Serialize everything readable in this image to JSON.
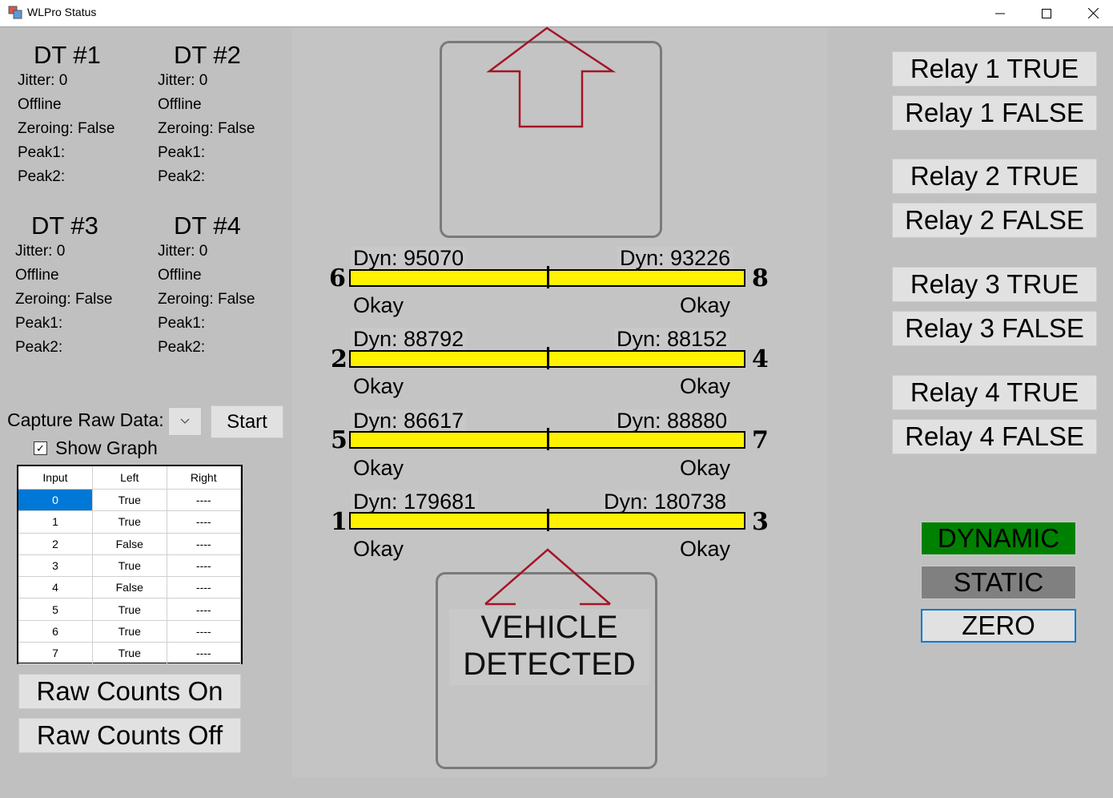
{
  "window": {
    "title": "WLPro Status"
  },
  "detectors": [
    {
      "title": "DT #1",
      "jitter": "Jitter: 0",
      "status": "Offline",
      "zeroing": "Zeroing: False",
      "peak1": "Peak1:",
      "peak2": "Peak2:"
    },
    {
      "title": "DT #2",
      "jitter": "Jitter: 0",
      "status": "Offline",
      "zeroing": "Zeroing: False",
      "peak1": "Peak1:",
      "peak2": "Peak2:"
    },
    {
      "title": "DT #3",
      "jitter": "Jitter: 0",
      "status": "Offline",
      "zeroing": "Zeroing: False",
      "peak1": "Peak1:",
      "peak2": "Peak2:"
    },
    {
      "title": "DT #4",
      "jitter": "Jitter: 0",
      "status": "Offline",
      "zeroing": "Zeroing: False",
      "peak1": "Peak1:",
      "peak2": "Peak2:"
    }
  ],
  "capture": {
    "label": "Capture Raw Data:",
    "start_label": "Start",
    "show_graph_label": "Show Graph",
    "show_graph_checked": true
  },
  "grid": {
    "headers": [
      "Input",
      "Left",
      "Right"
    ],
    "rows": [
      [
        "0",
        "True",
        "----"
      ],
      [
        "1",
        "True",
        "----"
      ],
      [
        "2",
        "False",
        "----"
      ],
      [
        "3",
        "True",
        "----"
      ],
      [
        "4",
        "False",
        "----"
      ],
      [
        "5",
        "True",
        "----"
      ],
      [
        "6",
        "True",
        "----"
      ],
      [
        "7",
        "True",
        "----"
      ]
    ],
    "selected_row": 0
  },
  "raw_counts": {
    "on_label": "Raw Counts On",
    "off_label": "Raw Counts Off"
  },
  "sensor_rows": [
    {
      "left_num": "6",
      "right_num": "8",
      "left_dyn": "Dyn: 95070",
      "right_dyn": "Dyn: 93226",
      "left_status": "Okay",
      "right_status": "Okay"
    },
    {
      "left_num": "2",
      "right_num": "4",
      "left_dyn": "Dyn: 88792",
      "right_dyn": "Dyn: 88152",
      "left_status": "Okay",
      "right_status": "Okay"
    },
    {
      "left_num": "5",
      "right_num": "7",
      "left_dyn": "Dyn: 86617",
      "right_dyn": "Dyn: 88880",
      "left_status": "Okay",
      "right_status": "Okay"
    },
    {
      "left_num": "1",
      "right_num": "3",
      "left_dyn": "Dyn: 179681",
      "right_dyn": "Dyn: 180738",
      "left_status": "Okay",
      "right_status": "Okay"
    }
  ],
  "vehicle": {
    "line1": "VEHICLE",
    "line2": "DETECTED"
  },
  "relays": [
    {
      "true_label": "Relay 1 TRUE",
      "false_label": "Relay 1 FALSE"
    },
    {
      "true_label": "Relay 2 TRUE",
      "false_label": "Relay 2 FALSE"
    },
    {
      "true_label": "Relay 3 TRUE",
      "false_label": "Relay 3 FALSE"
    },
    {
      "true_label": "Relay 4 TRUE",
      "false_label": "Relay 4 FALSE"
    }
  ],
  "modes": {
    "dynamic_label": "DYNAMIC",
    "static_label": "STATIC",
    "zero_label": "ZERO",
    "dynamic_color": "#008000",
    "static_color": "#808080",
    "zero_border_color": "#0078d7"
  },
  "colors": {
    "bar_fill": "#fff200",
    "arrow": "#a31526",
    "background": "#c0c0c0"
  },
  "icons": {
    "app": "app-window-icon",
    "arrow_up": "arrow-up-icon",
    "minimize": "minimize-icon",
    "maximize": "maximize-icon",
    "close": "close-icon"
  }
}
